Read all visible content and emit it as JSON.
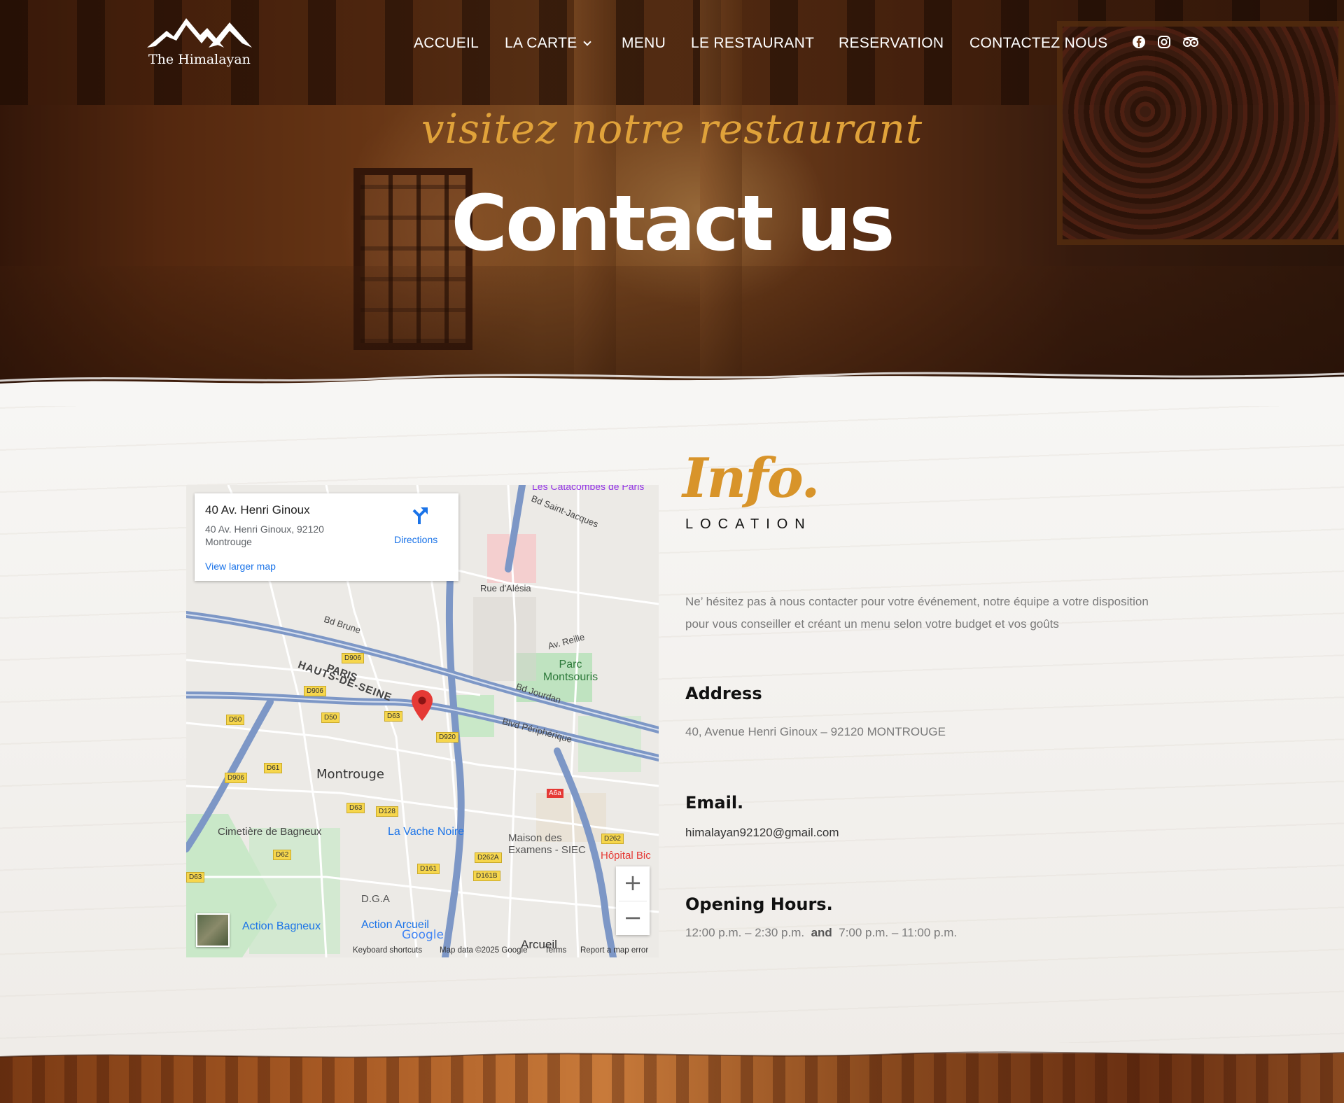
{
  "header": {
    "logo_text": "The Himalayan",
    "nav": [
      {
        "label": "ACCUEIL"
      },
      {
        "label": "LA CARTE",
        "has_dropdown": true
      },
      {
        "label": "MENU"
      },
      {
        "label": "LE RESTAURANT"
      },
      {
        "label": "RESERVATION"
      },
      {
        "label": "CONTACTEZ NOUS"
      }
    ],
    "social_icons": [
      "facebook-icon",
      "instagram-icon",
      "tripadvisor-icon"
    ]
  },
  "hero": {
    "script": "visitez notre restaurant",
    "title": "Contact us"
  },
  "map": {
    "place_title": "40 Av. Henri Ginoux",
    "place_address": "40 Av. Henri Ginoux, 92120 Montrouge",
    "directions_label": "Directions",
    "larger_map_label": "View larger map",
    "zoom_in": "+",
    "zoom_out": "−",
    "footer": {
      "shortcuts": "Keyboard shortcuts",
      "data": "Map data ©2025 Google",
      "terms": "Terms",
      "report": "Report a map error"
    },
    "labels": {
      "montrouge": "Montrouge",
      "parc": "Parc Montsouris",
      "paris": "PARIS",
      "hauts": "HAUTS-DE-SEINE",
      "cimetiere": "Cimetière de Bagneux",
      "vache": "La Vache Noire",
      "maison": "Maison des Examens - SIEC",
      "hopital": "Hôpital Bic",
      "dga": "D.G.A",
      "action_bagneux": "Action Bagneux",
      "action_arcueil": "Action Arcueil",
      "arcueil": "Arcueil",
      "bd_brune": "Bd Brune",
      "bd_jourdan": "Bd Jourdan",
      "bd_periph": "Blvd Périphérique",
      "rue_alesia": "Rue d'Alésia",
      "av_reille": "Av. Reille",
      "bd_st_jacques": "Bd Saint-Jacques",
      "catacombes": "Les Catacombes de Paris",
      "google": "Google"
    },
    "road_badges": [
      "D906",
      "D906",
      "D50",
      "D50",
      "D63",
      "D920",
      "D61",
      "D906",
      "D63",
      "D128",
      "D62",
      "D63",
      "D161",
      "D262A",
      "D161B",
      "D262",
      "A6a"
    ]
  },
  "info": {
    "script": "Info.",
    "subtitle": "LOCATION",
    "intro": "Ne’ hésitez pas à nous contacter pour votre événement, notre équipe a votre disposition pour vous conseiller et créant un menu selon votre budget et vos goûts",
    "address_heading": "Address",
    "address": "40, Avenue Henri Ginoux – 92120 MONTROUGE",
    "email_heading": "Email.",
    "email": "himalayan92120@gmail.com",
    "hours_heading": "Opening Hours.",
    "hours_1": "12:00 p.m. – 2:30 p.m.",
    "hours_and": "and",
    "hours_2": "7:00 p.m. – 11:00 p.m."
  },
  "colors": {
    "accent": "#d8942a",
    "hero_script": "#e0a23a",
    "link_blue": "#1a73e8",
    "road_badge": "#f6d64c",
    "map_pin": "#e53935"
  }
}
